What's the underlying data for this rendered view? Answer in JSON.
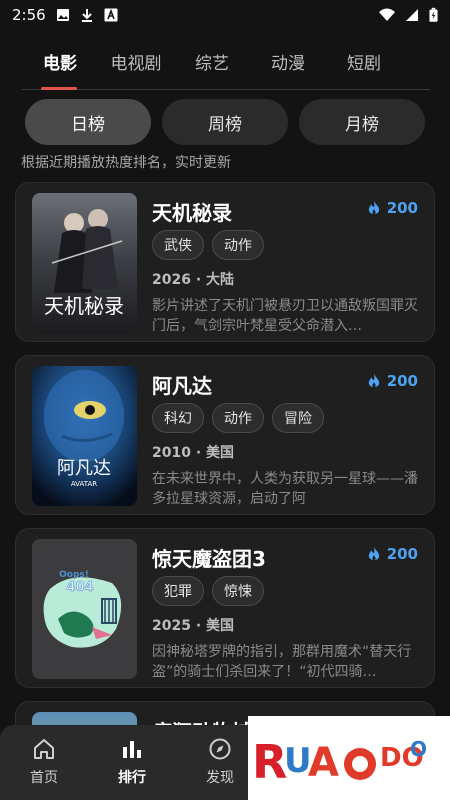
{
  "status_bar": {
    "time": "2:56",
    "left_icons": [
      "image-icon",
      "download-icon",
      "a-icon"
    ],
    "right_icons": [
      "wifi-icon",
      "signal-icon",
      "battery-icon"
    ]
  },
  "category_tabs": [
    {
      "label": "电影",
      "active": true
    },
    {
      "label": "电视剧",
      "active": false
    },
    {
      "label": "综艺",
      "active": false
    },
    {
      "label": "动漫",
      "active": false
    },
    {
      "label": "短剧",
      "active": false
    }
  ],
  "period_tabs": [
    {
      "label": "日榜",
      "active": true
    },
    {
      "label": "周榜",
      "active": false
    },
    {
      "label": "月榜",
      "active": false
    }
  ],
  "subtitle": "根据近期播放热度排名，实时更新",
  "items": [
    {
      "title": "天机秘录",
      "heat": "200",
      "tags": [
        "武侠",
        "动作"
      ],
      "meta": "2026 · 大陆",
      "desc": "影片讲述了天机门被悬刃卫以通敌叛国罪灭门后，气剑宗叶梵星受父命潜入…",
      "poster_text": "天机秘录"
    },
    {
      "title": "阿凡达",
      "heat": "200",
      "tags": [
        "科幻",
        "动作",
        "冒险"
      ],
      "meta": "2010 · 美国",
      "desc": "在未来世界中，人类为获取另一星球——潘多拉星球资源，启动了阿",
      "poster_text": "阿凡达",
      "poster_subtext": "AVATAR"
    },
    {
      "title": "惊天魔盗团3",
      "heat": "200",
      "tags": [
        "犯罪",
        "惊悚"
      ],
      "meta": "2025 · 美国",
      "desc": "因神秘塔罗牌的指引，那群用魔术“替天行盗”的骑士们杀回来了！“初代四骑…",
      "poster_text": "Oops!",
      "poster_code": "404"
    },
    {
      "title": "疯狂动物城"
    }
  ],
  "bottom_nav": [
    {
      "label": "首页",
      "icon": "home-icon",
      "active": false
    },
    {
      "label": "排行",
      "icon": "ranking-icon",
      "active": true
    },
    {
      "label": "发现",
      "icon": "compass-icon",
      "active": false
    }
  ],
  "colors": {
    "accent": "#e0554c",
    "heat": "#4da3f2",
    "background": "#131313",
    "card": "#1f1f1f"
  }
}
